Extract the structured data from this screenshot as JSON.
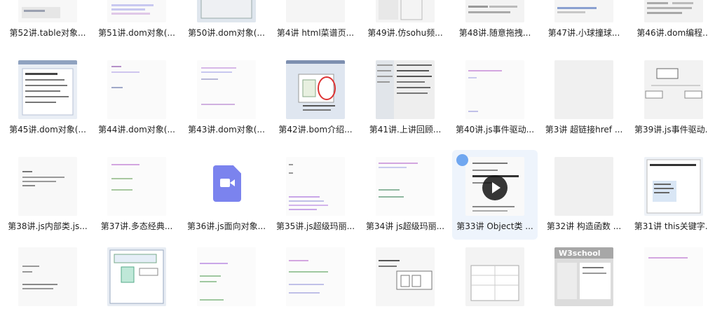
{
  "files": [
    {
      "label": "第52讲.table对象..."
    },
    {
      "label": "第51讲.dom对象(..."
    },
    {
      "label": "第50讲.dom对象(..."
    },
    {
      "label": "第4讲 html菜谱页..."
    },
    {
      "label": "第49讲.仿sohu频..."
    },
    {
      "label": "第48讲.随意拖拽..."
    },
    {
      "label": "第47讲.小球撞球..."
    },
    {
      "label": "第46讲.dom编程..."
    },
    {
      "label": "第45讲.dom对象(..."
    },
    {
      "label": "第44讲.dom对象(..."
    },
    {
      "label": "第43讲.dom对象(..."
    },
    {
      "label": "第42讲.bom介绍..."
    },
    {
      "label": "第41讲.上讲回顾..."
    },
    {
      "label": "第40讲.js事件驱动..."
    },
    {
      "label": "第3讲 超链接href ..."
    },
    {
      "label": "第39讲.js事件驱动..."
    },
    {
      "label": "第38讲.js内部类.js..."
    },
    {
      "label": "第37讲.多态经典..."
    },
    {
      "label": "第36讲.js面向对象..."
    },
    {
      "label": "第35讲.js超级玛丽..."
    },
    {
      "label": "第34讲 js超级玛丽..."
    },
    {
      "label": "第33讲 Object类 ..."
    },
    {
      "label": "第32讲 构造函数 ..."
    },
    {
      "label": "第31讲 this关键字..."
    },
    {
      "label": ""
    },
    {
      "label": ""
    },
    {
      "label": ""
    },
    {
      "label": ""
    },
    {
      "label": ""
    },
    {
      "label": ""
    },
    {
      "label": ""
    },
    {
      "label": ""
    }
  ],
  "thumbnail_texts": {
    "w3school": "W3school"
  },
  "colors": {
    "selected_bg": "#eef4fc",
    "check": "#70a7f0",
    "video_icon": "#7b83ee"
  }
}
